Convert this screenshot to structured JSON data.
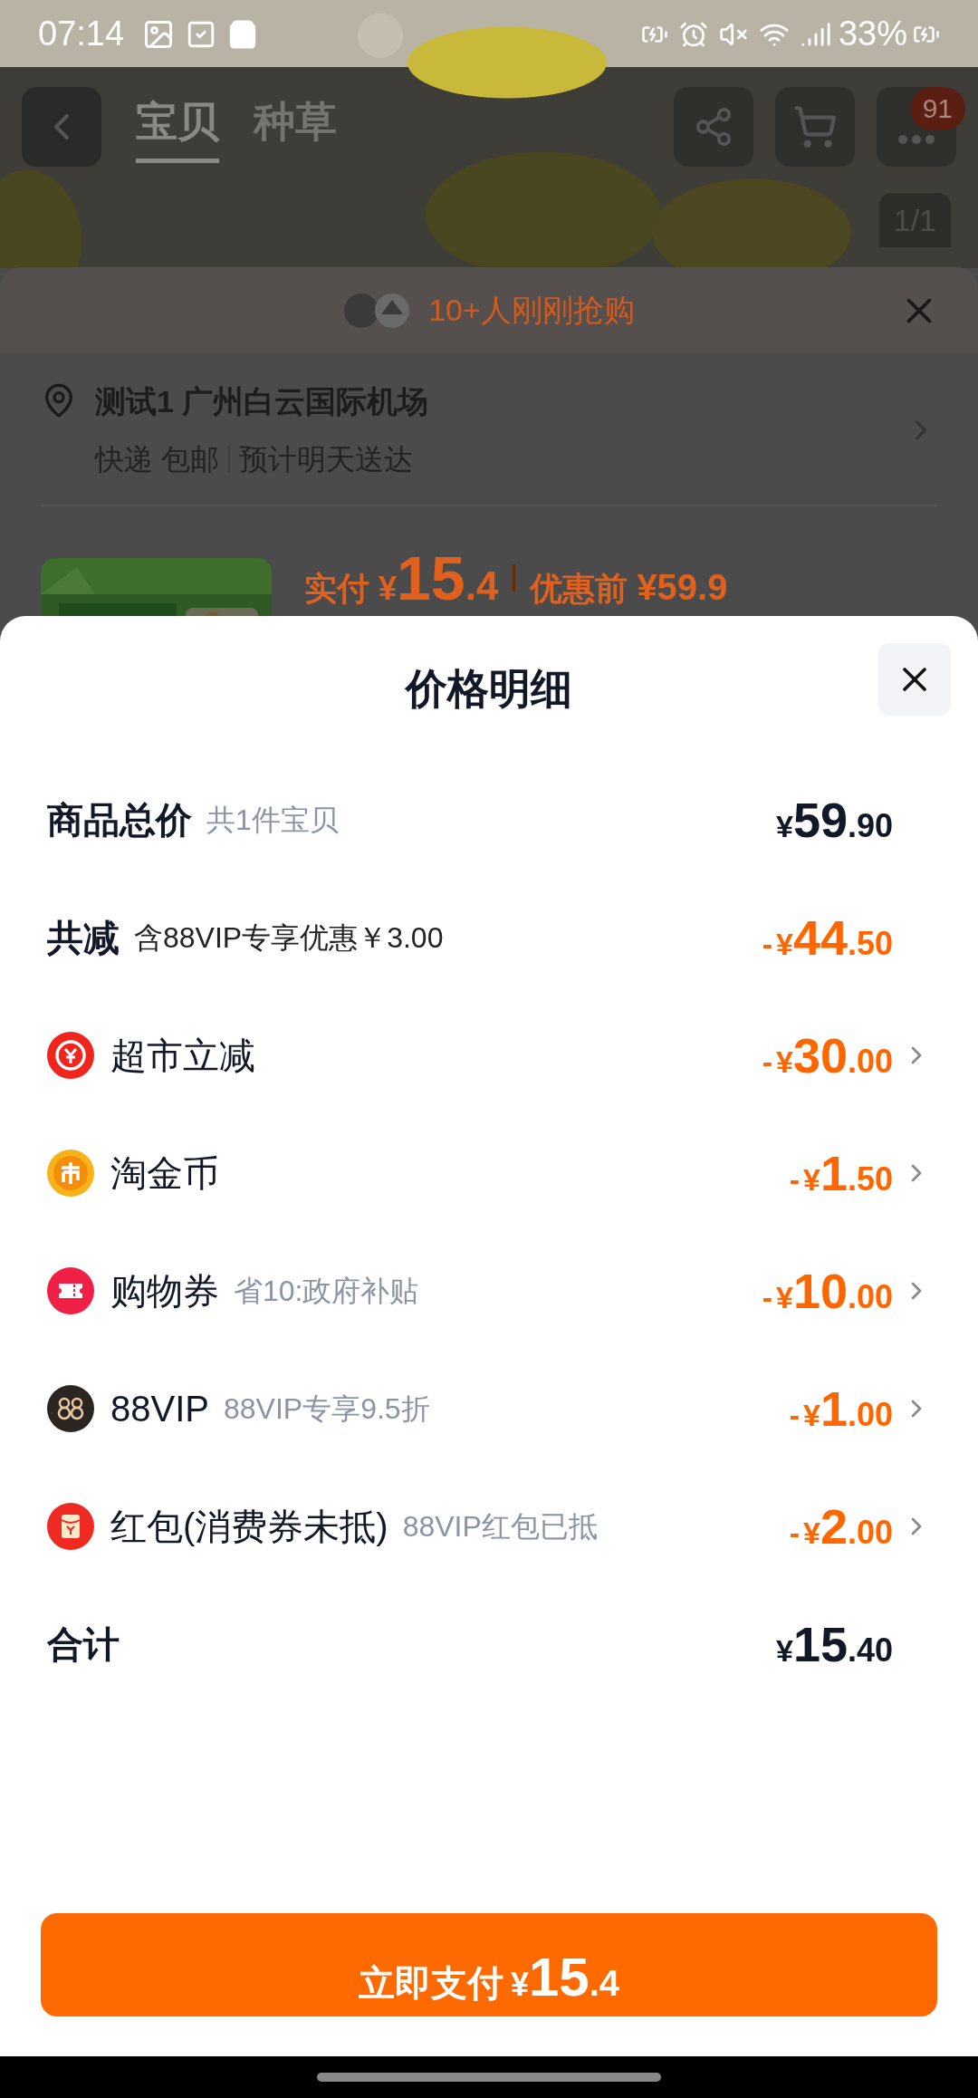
{
  "status_bar": {
    "time": "07:14",
    "battery": "33%"
  },
  "header": {
    "tabs": [
      {
        "label": "宝贝",
        "selected": true
      },
      {
        "label": "种草",
        "selected": false
      }
    ],
    "badge": "91",
    "page_indicator": "1/1"
  },
  "sheet": {
    "buyers_note": "10+人刚刚抢购",
    "address": "测试1 广州白云国际机场",
    "delivery": "快递 包邮",
    "eta": "预计明天送达",
    "paid_label": "实付",
    "paid_price": "¥15.4",
    "original_label": "优惠前",
    "original_price": "¥59.9"
  },
  "price_detail": {
    "title": "价格明细",
    "rows": [
      {
        "kind": "heading",
        "label": "商品总价",
        "note": "共1件宝贝",
        "amount": "¥59.90",
        "discount": false
      },
      {
        "kind": "heading",
        "label": "共减",
        "note": "含88VIP专享优惠￥3.00",
        "amount": "-¥44.50",
        "discount": true
      },
      {
        "kind": "item",
        "label": "超市立减",
        "amount": "-¥30.00",
        "discount": true
      },
      {
        "kind": "item",
        "label": "淘金币",
        "amount": "-¥1.50",
        "discount": true
      },
      {
        "kind": "item",
        "label": "购物券",
        "note": "省10:政府补贴",
        "amount": "-¥10.00",
        "discount": true
      },
      {
        "kind": "item",
        "label": "88VIP",
        "note": "88VIP专享9.5折",
        "amount": "-¥1.00",
        "discount": true
      },
      {
        "kind": "item",
        "label": "红包(消费券未抵)",
        "note": "88VIP红包已抵",
        "amount": "-¥2.00",
        "discount": true
      },
      {
        "kind": "heading",
        "label": "合计",
        "amount": "¥15.40",
        "discount": false
      }
    ],
    "pay_button": {
      "label": "立即支付",
      "price": "¥15.4"
    }
  }
}
